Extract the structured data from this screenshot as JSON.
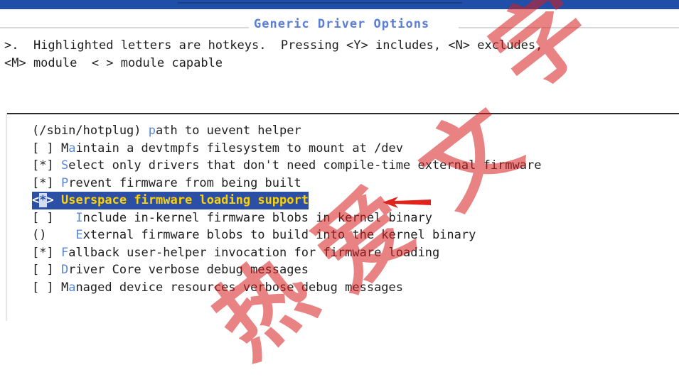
{
  "window": {
    "title": "Generic Driver Options",
    "help_line_1": ">.  Highlighted letters are hotkeys.  Pressing <Y> includes, <N> excludes,",
    "help_line_2": "<M> module  < > module capable"
  },
  "colors": {
    "top_band": "#1f4fa8",
    "title": "#5a7dd8",
    "hotkey": "#5b86d6",
    "selection_bg": "#2c4fa6",
    "selection_text": "#ffd200",
    "arrow": "#e0241b",
    "watermark": "#d71e1e"
  },
  "menu": {
    "items": [
      {
        "prefix": "(/sbin/hotplug) ",
        "hotkey": "p",
        "rest": "ath to uevent helper"
      },
      {
        "prefix": "[ ] M",
        "hotkey": "a",
        "rest": "intain a devtmpfs filesystem to mount at /dev"
      },
      {
        "prefix": "[*] ",
        "hotkey": "S",
        "rest": "elect only drivers that don't need compile-time external firmware"
      },
      {
        "prefix": "[*] ",
        "hotkey": "P",
        "rest": "revent firmware from being built"
      },
      {
        "prefix": "<*> ",
        "hotkey": "U",
        "rest": "serspace firmware loading support",
        "selected": true
      },
      {
        "prefix": "[ ]   ",
        "hotkey": "I",
        "rest": "nclude in-kernel firmware blobs in kernel binary"
      },
      {
        "prefix": "()    ",
        "hotkey": "E",
        "rest": "xternal firmware blobs to build into the kernel binary"
      },
      {
        "prefix": "[*] ",
        "hotkey": "F",
        "rest": "allback user-helper invocation for firmware loading"
      },
      {
        "prefix": "[ ] ",
        "hotkey": "D",
        "rest": "river Core verbose debug messages"
      },
      {
        "prefix": "[ ] M",
        "hotkey": "a",
        "rest": "naged device resources verbose debug messages"
      }
    ],
    "selected": {
      "bracket_open": "<",
      "mark": "*",
      "bracket_close": ">",
      "space": " ",
      "label": "Userspace firmware loading support"
    }
  },
  "annotation": {
    "arrow_icon": "red-left-arrow-icon"
  },
  "watermark": {
    "glyphs": [
      "热",
      "爱",
      "文",
      "字"
    ]
  }
}
